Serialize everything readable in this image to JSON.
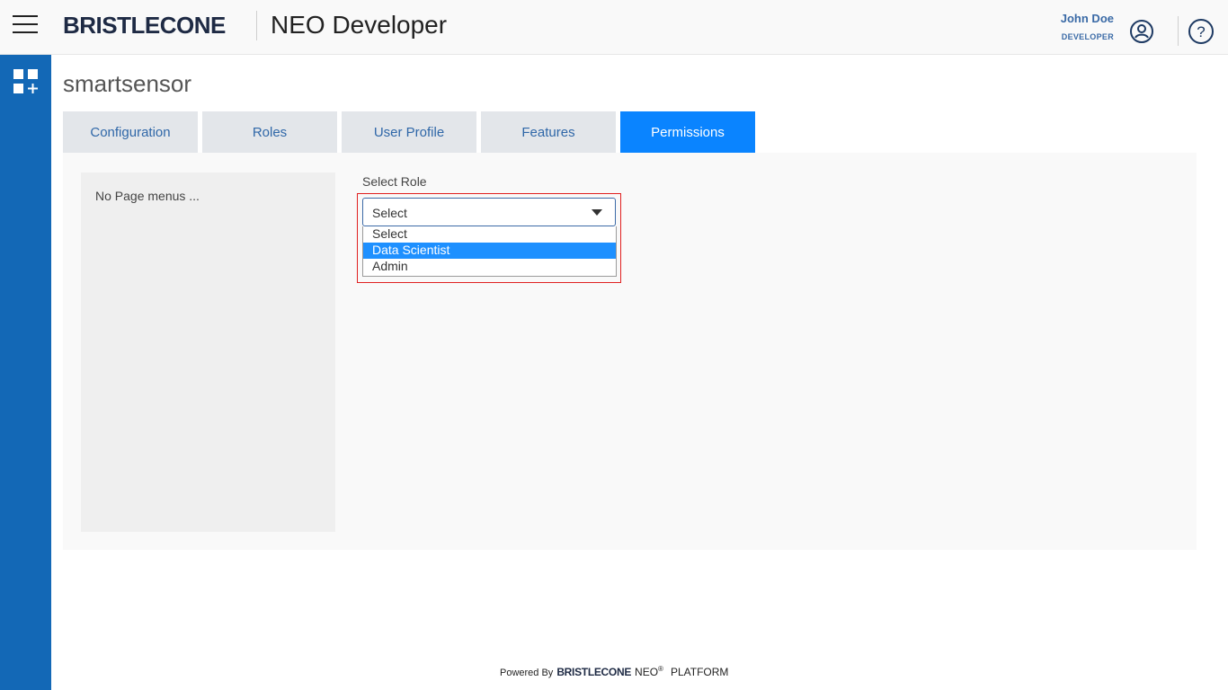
{
  "header": {
    "brand": "BRISTLECONE",
    "app_title": "NEO Developer",
    "user_name": "John Doe",
    "user_role": "DEVELOPER"
  },
  "page": {
    "title": "smartsensor"
  },
  "tabs": [
    {
      "label": "Configuration",
      "active": false
    },
    {
      "label": "Roles",
      "active": false
    },
    {
      "label": "User Profile",
      "active": false
    },
    {
      "label": "Features",
      "active": false
    },
    {
      "label": "Permissions",
      "active": true
    }
  ],
  "menus_panel": {
    "empty_text": "No Page menus ..."
  },
  "role_select": {
    "label": "Select Role",
    "value": "Select",
    "options": [
      "Select",
      "Data Scientist",
      "Admin"
    ],
    "highlighted_option": "Data Scientist"
  },
  "footer": {
    "powered_by": "Powered By",
    "brand": "BRISTLECONE",
    "neo": "NEO",
    "registered": "®",
    "platform": "PLATFORM"
  },
  "colors": {
    "sidebar": "#1368b6",
    "active_tab": "#0a84ff",
    "tab_inactive": "#e3e6ea",
    "option_highlight": "#1e90ff",
    "callout_border": "#e02020"
  },
  "icons": {
    "menu": "hamburger-icon",
    "apps": "grid-plus-icon",
    "user": "user-circle-icon",
    "help": "help-circle-icon",
    "dropdown": "caret-down-icon"
  }
}
